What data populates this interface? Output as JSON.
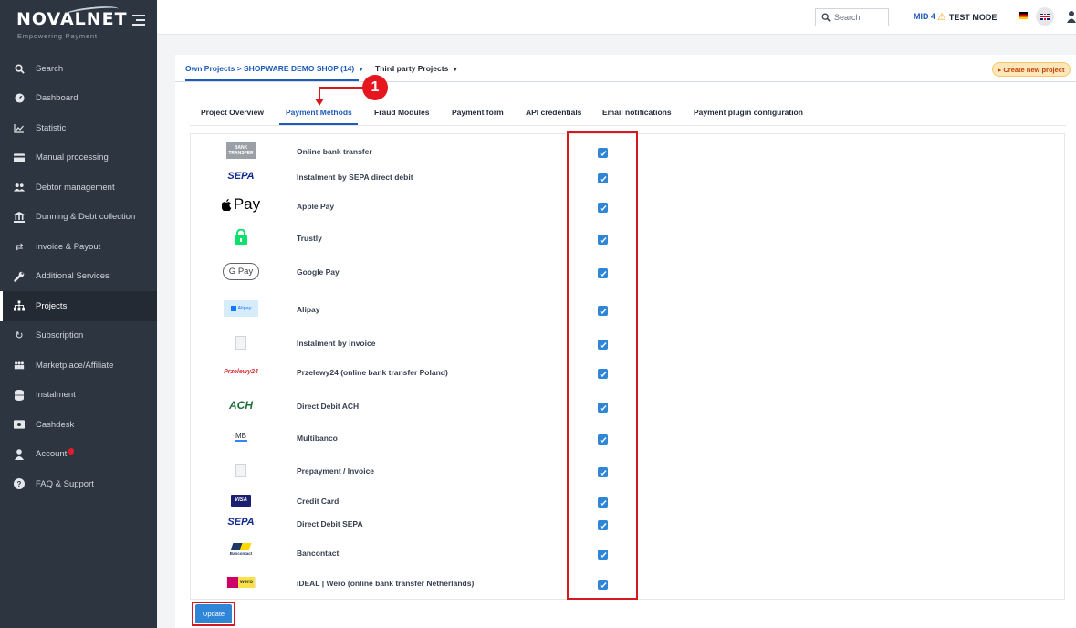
{
  "brand": {
    "name": "NOVALNET",
    "tagline": "Empowering Payment"
  },
  "sidebar": {
    "items": [
      {
        "label": "Search",
        "icon": "search-icon"
      },
      {
        "label": "Dashboard",
        "icon": "dashboard-icon"
      },
      {
        "label": "Statistic",
        "icon": "chart-line-icon"
      },
      {
        "label": "Manual processing",
        "icon": "credit-card-icon"
      },
      {
        "label": "Debtor management",
        "icon": "users-icon"
      },
      {
        "label": "Dunning & Debt collection",
        "icon": "bank-icon"
      },
      {
        "label": "Invoice & Payout",
        "icon": "exchange-icon"
      },
      {
        "label": "Additional Services",
        "icon": "wrench-icon"
      },
      {
        "label": "Projects",
        "icon": "sitemap-icon",
        "active": true
      },
      {
        "label": "Subscription",
        "icon": "refresh-icon"
      },
      {
        "label": "Marketplace/Affiliate",
        "icon": "group-icon"
      },
      {
        "label": "Instalment",
        "icon": "database-icon"
      },
      {
        "label": "Cashdesk",
        "icon": "cash-register-icon"
      },
      {
        "label": "Account",
        "icon": "user-icon"
      },
      {
        "label": "FAQ & Support",
        "icon": "question-icon"
      }
    ]
  },
  "topbar": {
    "search_placeholder": "Search",
    "mid": "MID 4",
    "test_mode": "TEST MODE"
  },
  "project": {
    "own_projects": "Own Projects > SHOPWARE DEMO SHOP (14)",
    "third_party": "Third party Projects",
    "create_new": "Create new project"
  },
  "tabs": [
    {
      "label": "Project Overview"
    },
    {
      "label": "Payment Methods",
      "active": true
    },
    {
      "label": "Fraud Modules"
    },
    {
      "label": "Payment form"
    },
    {
      "label": "API credentials"
    },
    {
      "label": "Email notifications"
    },
    {
      "label": "Payment plugin configuration"
    }
  ],
  "payment_methods": [
    {
      "name": "Online bank transfer",
      "logo": "bank-transfer-logo",
      "logo_text": "BANK TRANSFER",
      "checked": true
    },
    {
      "name": "Instalment by SEPA direct debit",
      "logo": "sepa-logo",
      "logo_text": "SEPA",
      "checked": true
    },
    {
      "name": "Apple Pay",
      "logo": "apple-pay-logo",
      "logo_text": "Pay",
      "checked": true
    },
    {
      "name": "Trustly",
      "logo": "trustly-logo",
      "logo_text": "",
      "checked": true
    },
    {
      "name": "Google Pay",
      "logo": "google-pay-logo",
      "logo_text": "G Pay",
      "checked": true
    },
    {
      "name": "Alipay",
      "logo": "alipay-logo",
      "logo_text": "Alipay",
      "checked": true
    },
    {
      "name": "Instalment by invoice",
      "logo": "invoice-logo",
      "logo_text": "",
      "checked": true
    },
    {
      "name": "Przelewy24 (online bank transfer Poland)",
      "logo": "przelewy24-logo",
      "logo_text": "Przelewy24",
      "checked": true
    },
    {
      "name": "Direct Debit ACH",
      "logo": "ach-logo",
      "logo_text": "ACH",
      "checked": true
    },
    {
      "name": "Multibanco",
      "logo": "multibanco-logo",
      "logo_text": "MB",
      "checked": true
    },
    {
      "name": "Prepayment / Invoice",
      "logo": "prepayment-logo",
      "logo_text": "",
      "checked": true
    },
    {
      "name": "Credit Card",
      "logo": "visa-logo",
      "logo_text": "VISA",
      "checked": true
    },
    {
      "name": "Direct Debit SEPA",
      "logo": "sepa-logo",
      "logo_text": "SEPA",
      "checked": true
    },
    {
      "name": "Bancontact",
      "logo": "bancontact-logo",
      "logo_text": "Bancontact",
      "checked": true
    },
    {
      "name": "iDEAL | Wero (online bank transfer Netherlands)",
      "logo": "ideal-wero-logo",
      "logo_text": "wero",
      "checked": true
    }
  ],
  "actions": {
    "update_label": "Update"
  },
  "annotation": {
    "step_number": "1"
  },
  "colors": {
    "sidebar_bg": "#2d3540",
    "accent": "#1e5bb8",
    "checkbox": "#2f86d6",
    "annotation_red": "#d7191f"
  }
}
